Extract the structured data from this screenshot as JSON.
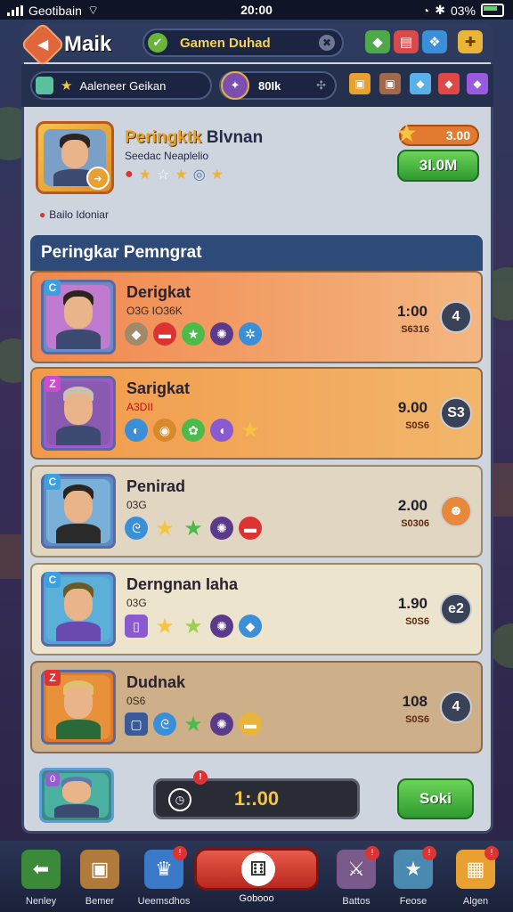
{
  "status": {
    "carrier": "Geotibain",
    "time": "20:00",
    "battery": "03%"
  },
  "header": {
    "title": "Maik",
    "search_text": "Gamen Duhad"
  },
  "subbar": {
    "filter_text": "Aaleneer Geikan",
    "score_text": "80Ik"
  },
  "profile": {
    "title_a": "Peringktk",
    "title_b": "Blvnan",
    "subtitle": "Seedac Neaplelio",
    "note": "Bailo Idoniar",
    "coins": "3.00",
    "button": "3l.0M"
  },
  "leaderboard": {
    "title": "Peringkar Pemngrat",
    "rows": [
      {
        "rank": "C",
        "name": "Derigkat",
        "sub": "O3G IO36K",
        "value": "1:00",
        "sub_value": "S6316",
        "badge": "4"
      },
      {
        "rank": "Z",
        "name": "Sarigkat",
        "sub": "A3DII",
        "value": "9.00",
        "sub_value": "S0S6",
        "badge": "S3"
      },
      {
        "rank": "C",
        "name": "Penirad",
        "sub": "03G",
        "value": "2.00",
        "sub_value": "S0306",
        "badge": ""
      },
      {
        "rank": "C",
        "name": "Derngnan Iaha",
        "sub": "03G",
        "value": "1.90",
        "sub_value": "S0S6",
        "badge": "e2"
      },
      {
        "rank": "Z",
        "name": "Dudnak",
        "sub": "0S6",
        "value": "108",
        "sub_value": "S0S6",
        "badge": "4"
      }
    ]
  },
  "self": {
    "timer": "1:.00",
    "button": "Soki"
  },
  "nav": {
    "items": [
      {
        "label": "Nenley"
      },
      {
        "label": "Bemer"
      },
      {
        "label": "Ueemsdhos"
      },
      {
        "label": "Gobooo"
      },
      {
        "label": "Battos"
      },
      {
        "label": "Feose"
      },
      {
        "label": "Algen"
      }
    ]
  },
  "colors": {
    "accent": "#f5c542",
    "green": "#3fae3a",
    "orange": "#e27a2f",
    "navy": "#2e3b5e"
  }
}
